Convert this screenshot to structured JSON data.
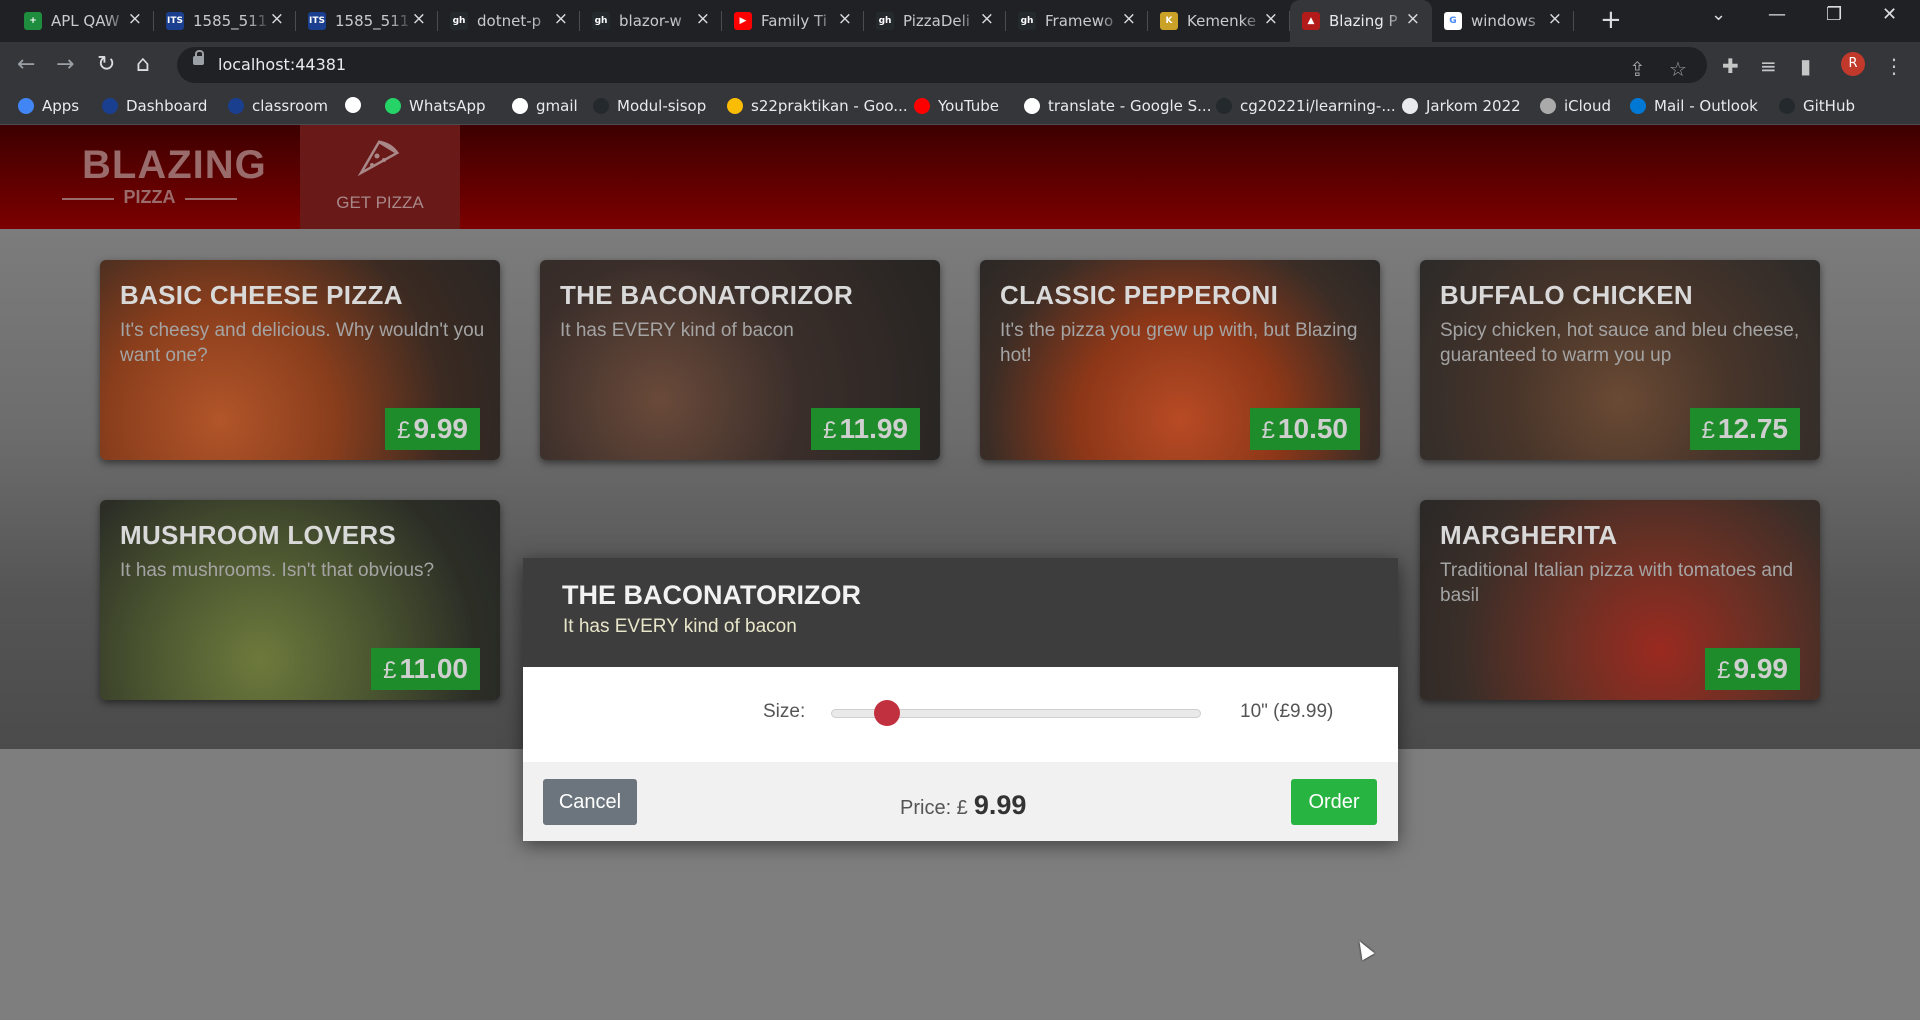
{
  "browser": {
    "tabs": [
      {
        "title": "APL QAW",
        "favicon_color": "#1e8e3e",
        "favicon_glyph": "+"
      },
      {
        "title": "1585_511",
        "favicon_color": "#1a3f8f",
        "favicon_glyph": "ITS"
      },
      {
        "title": "1585_511",
        "favicon_color": "#1a3f8f",
        "favicon_glyph": "ITS"
      },
      {
        "title": "dotnet-p",
        "favicon_color": "#24292e",
        "favicon_glyph": "gh"
      },
      {
        "title": "blazor-w",
        "favicon_color": "#24292e",
        "favicon_glyph": "gh"
      },
      {
        "title": "Family Ti",
        "favicon_color": "#ff0000",
        "favicon_glyph": "▶"
      },
      {
        "title": "PizzaDeli",
        "favicon_color": "#24292e",
        "favicon_glyph": "gh"
      },
      {
        "title": "Framewo",
        "favicon_color": "#24292e",
        "favicon_glyph": "gh"
      },
      {
        "title": "Kemenke",
        "favicon_color": "#c9a227",
        "favicon_glyph": "K"
      },
      {
        "title": "Blazing P",
        "favicon_color": "#b31b1b",
        "favicon_glyph": "▲"
      },
      {
        "title": "windows",
        "favicon_color": "#ffffff",
        "favicon_glyph": "G"
      }
    ],
    "address": "localhost:44381",
    "avatar_letter": "R",
    "bookmarks": [
      {
        "label": "Apps",
        "icon_color": "#4285f4"
      },
      {
        "label": "Dashboard",
        "icon_color": "#1a3f8f"
      },
      {
        "label": "classroom",
        "icon_color": "#1a3f8f"
      },
      {
        "label": "",
        "icon_color": "#ffffff"
      },
      {
        "label": "WhatsApp",
        "icon_color": "#25d366"
      },
      {
        "label": "gmail",
        "icon_color": "#ffffff"
      },
      {
        "label": "Modul-sisop",
        "icon_color": "#24292e"
      },
      {
        "label": "s22praktikan - Goo...",
        "icon_color": "#fbbc04"
      },
      {
        "label": "YouTube",
        "icon_color": "#ff0000"
      },
      {
        "label": "translate - Google S...",
        "icon_color": "#ffffff"
      },
      {
        "label": "cg20221i/learning-...",
        "icon_color": "#24292e"
      },
      {
        "label": "Jarkom 2022",
        "icon_color": "#e8eaed"
      },
      {
        "label": "iCloud",
        "icon_color": "#aaaaaa"
      },
      {
        "label": "Mail - Outlook",
        "icon_color": "#0078d4"
      },
      {
        "label": "GitHub",
        "icon_color": "#24292e"
      }
    ]
  },
  "app": {
    "logo_top": "BLAZING",
    "logo_bottom": "PIZZA",
    "nav_get_pizza": "GET PIZZA",
    "currency": "£",
    "specials": [
      {
        "name": "BASIC CHEESE PIZZA",
        "description": "It's cheesy and delicious. Why wouldn't you want one?",
        "price": "9.99"
      },
      {
        "name": "THE BACONATORIZOR",
        "description": "It has EVERY kind of bacon",
        "price": "11.99"
      },
      {
        "name": "CLASSIC PEPPERONI",
        "description": "It's the pizza you grew up with, but Blazing hot!",
        "price": "10.50"
      },
      {
        "name": "BUFFALO CHICKEN",
        "description": "Spicy chicken, hot sauce and bleu cheese, guaranteed to warm you up",
        "price": "12.75"
      },
      {
        "name": "MUSHROOM LOVERS",
        "description": "It has mushrooms. Isn't that obvious?",
        "price": "11.00"
      },
      {
        "name": "MARGHERITA",
        "description": "Traditional Italian pizza with tomatoes and basil",
        "price": "9.99"
      }
    ],
    "dialog": {
      "title": "THE BACONATORIZOR",
      "subtitle": "It has EVERY kind of bacon",
      "size_label": "Size:",
      "size_value": "10\" (£9.99)",
      "slider_fraction": 0.15,
      "price_label": "Price: £",
      "price": "9.99",
      "cancel_label": "Cancel",
      "order_label": "Order"
    }
  }
}
